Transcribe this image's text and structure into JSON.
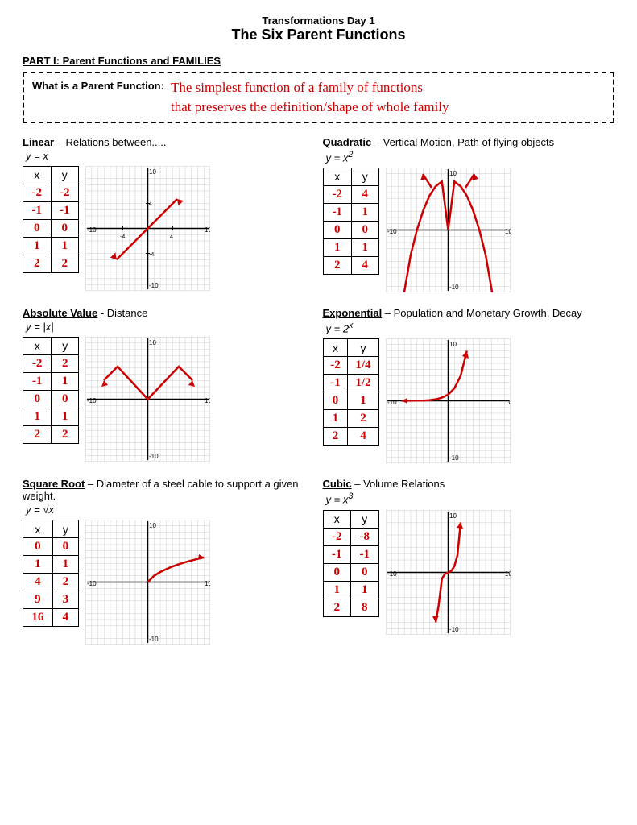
{
  "header": {
    "subtitle": "Transformations Day 1",
    "title": "The Six Parent Functions"
  },
  "part1": {
    "label": "PART I: Parent Functions and FAMILIES",
    "def_label": "What is a Parent Function:",
    "def_text": "The simplest function of a family of functions\nthat preserves the definition/shape of whole family"
  },
  "functions": [
    {
      "id": "linear",
      "name": "Linear",
      "desc": " – Relations between.....",
      "equation": "y = x",
      "table": {
        "headers": [
          "x",
          "y"
        ],
        "rows": [
          [
            "-2",
            "-2"
          ],
          [
            "-1",
            "-1"
          ],
          [
            "0",
            "0"
          ],
          [
            "1",
            "1"
          ],
          [
            "2",
            "2"
          ]
        ]
      },
      "graph_type": "linear"
    },
    {
      "id": "quadratic",
      "name": "Quadratic",
      "desc": " – Vertical Motion, Path of flying objects",
      "equation": "y = x²",
      "table": {
        "headers": [
          "x",
          "y"
        ],
        "rows": [
          [
            "-2",
            "4"
          ],
          [
            "-1",
            "1"
          ],
          [
            "0",
            "0"
          ],
          [
            "1",
            "1"
          ],
          [
            "2",
            "4"
          ]
        ]
      },
      "graph_type": "quadratic"
    },
    {
      "id": "absolute",
      "name": "Absolute Value",
      "desc": " - Distance",
      "equation": "y = |x|",
      "table": {
        "headers": [
          "x",
          "y"
        ],
        "rows": [
          [
            "-2",
            "2"
          ],
          [
            "-1",
            "1"
          ],
          [
            "0",
            "0"
          ],
          [
            "1",
            "1"
          ],
          [
            "2",
            "2"
          ]
        ]
      },
      "graph_type": "absolute"
    },
    {
      "id": "exponential",
      "name": "Exponential",
      "desc": " – Population and Monetary Growth, Decay",
      "equation": "y = 2ˣ",
      "table": {
        "headers": [
          "x",
          "y"
        ],
        "rows": [
          [
            "-2",
            "1/4"
          ],
          [
            "-1",
            "1/2"
          ],
          [
            "0",
            "1"
          ],
          [
            "1",
            "2"
          ],
          [
            "2",
            "4"
          ]
        ]
      },
      "graph_type": "exponential"
    },
    {
      "id": "squareroot",
      "name": "Square Root",
      "desc": " – Diameter of a steel cable to support a given weight.",
      "equation": "y = √x",
      "table": {
        "headers": [
          "x",
          "y"
        ],
        "rows": [
          [
            "0",
            "0"
          ],
          [
            "1",
            "1"
          ],
          [
            "4",
            "2"
          ],
          [
            "9",
            "3"
          ],
          [
            "16",
            "4"
          ]
        ]
      },
      "graph_type": "squareroot"
    },
    {
      "id": "cubic",
      "name": "Cubic",
      "desc": " – Volume Relations",
      "equation": "y = x³",
      "table": {
        "headers": [
          "x",
          "y"
        ],
        "rows": [
          [
            "-2",
            "-8"
          ],
          [
            "-1",
            "-1"
          ],
          [
            "0",
            "0"
          ],
          [
            "1",
            "1"
          ],
          [
            "2",
            "8"
          ]
        ]
      },
      "graph_type": "cubic"
    }
  ]
}
